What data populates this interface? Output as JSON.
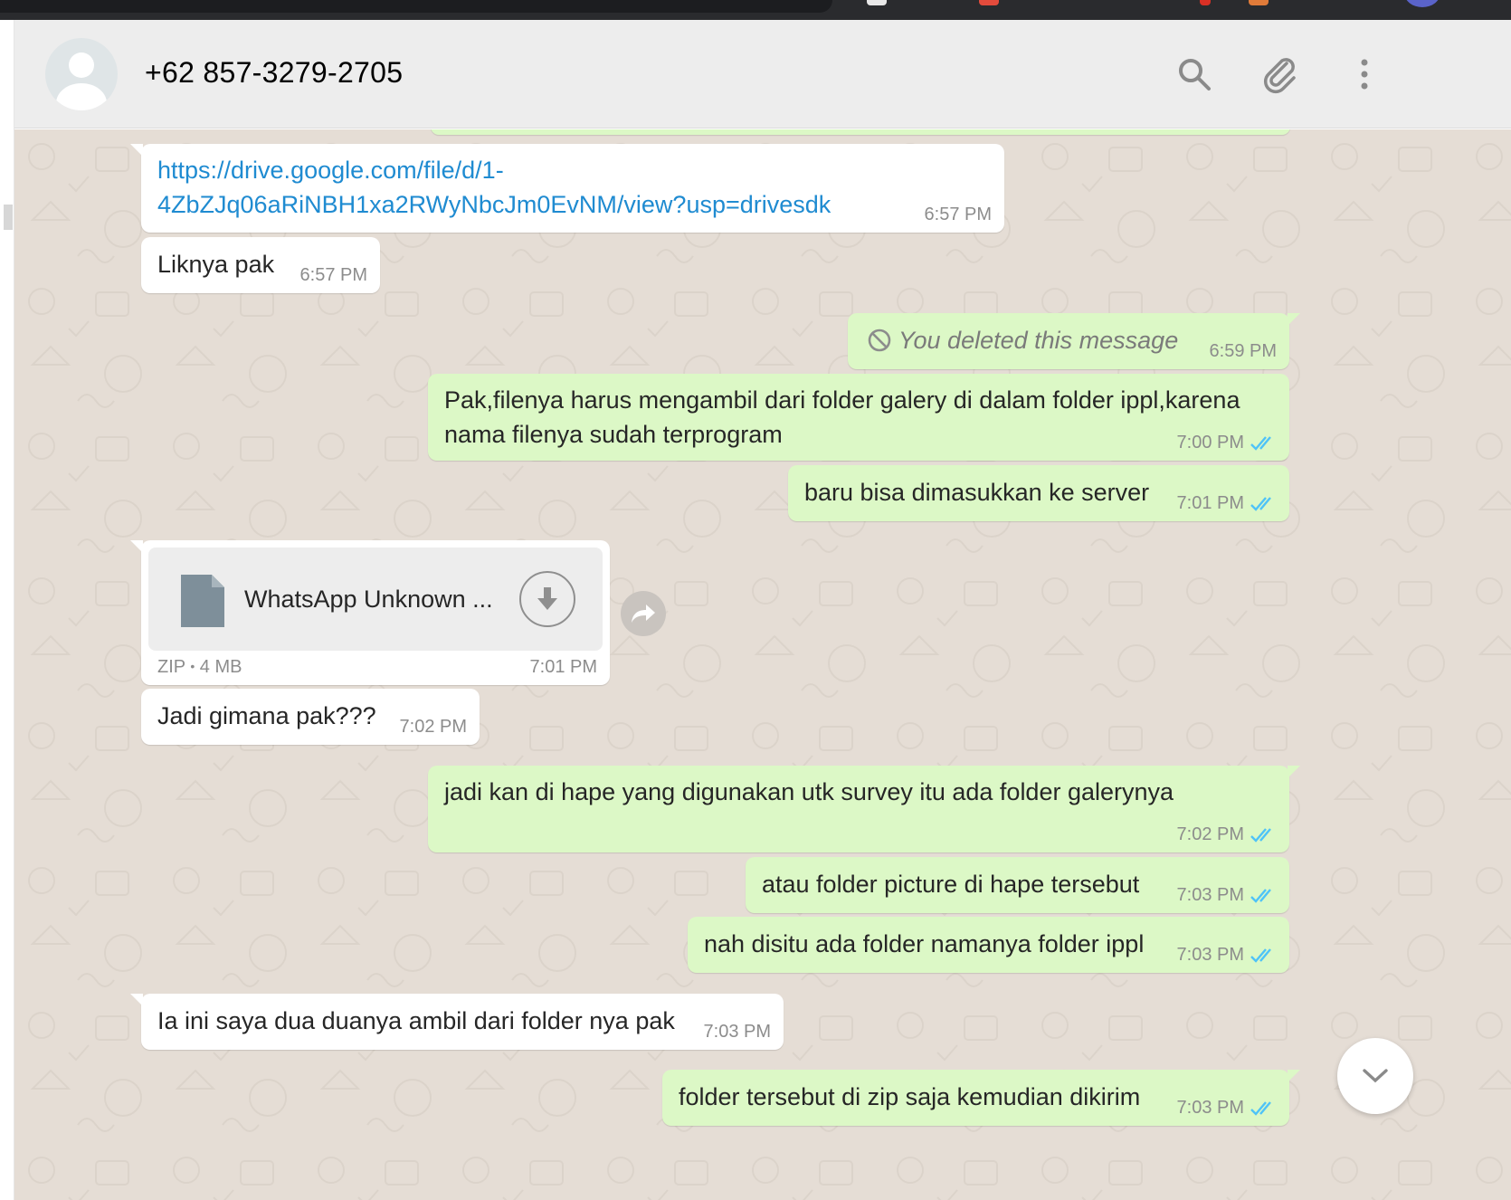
{
  "header": {
    "contact_name": "+62 857-3279-2705"
  },
  "icons": {
    "search": "search-icon",
    "attach": "paperclip-icon",
    "menu": "kebab-menu-icon",
    "avatar": "default-avatar-icon",
    "file": "document-icon",
    "download": "download-icon",
    "forward": "forward-icon",
    "scroll_down": "chevron-down-icon",
    "deleted": "prohibited-icon",
    "read_receipt": "double-check-icon"
  },
  "colors": {
    "incoming_bubble": "#ffffff",
    "outgoing_bubble": "#dcf8c6",
    "chat_background": "#e5ddd5",
    "link": "#1f8bd1",
    "read_tick": "#4fc3f7"
  },
  "messages": [
    {
      "direction": "in",
      "line1": "https://drive.google.com/file/d/1-",
      "line2": "4ZbZJq06aRiNBH1xa2RWyNbcJm0EvNM/view?usp=drivesdk",
      "time": "6:57 PM"
    },
    {
      "direction": "in",
      "text": "Liknya pak",
      "time": "6:57 PM"
    },
    {
      "direction": "out",
      "text": "You deleted this message",
      "time": "6:59 PM"
    },
    {
      "direction": "out",
      "line1": "Pak,filenya harus mengambil dari folder galery di dalam folder ippl,karena",
      "line2": "nama filenya sudah terprogram",
      "time": "7:00 PM"
    },
    {
      "direction": "out",
      "text": "baru bisa dimasukkan ke server",
      "time": "7:01 PM"
    },
    {
      "direction": "in",
      "file_name": "WhatsApp Unknown ...",
      "file_type": "ZIP",
      "file_size": "4 MB",
      "time": "7:01 PM"
    },
    {
      "direction": "in",
      "text": "Jadi gimana pak???",
      "time": "7:02 PM"
    },
    {
      "direction": "out",
      "text": "jadi kan di hape yang digunakan utk survey itu ada folder galerynya",
      "time": "7:02 PM"
    },
    {
      "direction": "out",
      "text": "atau folder picture di hape tersebut",
      "time": "7:03 PM"
    },
    {
      "direction": "out",
      "text": "nah disitu ada folder namanya folder ippl",
      "time": "7:03 PM"
    },
    {
      "direction": "in",
      "text": "Ia ini saya dua duanya ambil dari folder nya pak",
      "time": "7:03 PM"
    },
    {
      "direction": "out",
      "text": "folder tersebut di zip saja kemudian dikirim",
      "time": "7:03 PM"
    }
  ]
}
